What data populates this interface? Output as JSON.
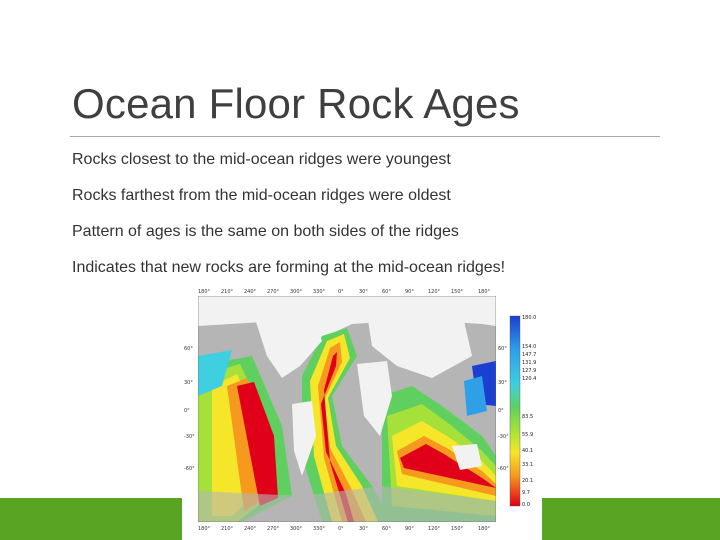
{
  "slide": {
    "title": "Ocean Floor Rock Ages",
    "bullets": [
      "Rocks closest to the mid-ocean ridges were youngest",
      "Rocks farthest from the mid-ocean ridges were oldest",
      "Pattern of ages is the same on both sides of the ridges",
      "Indicates that new rocks are forming at the mid-ocean ridges!"
    ]
  },
  "map": {
    "top_ticks": [
      "180°",
      "210°",
      "240°",
      "270°",
      "300°",
      "330°",
      "0°",
      "30°",
      "60°",
      "90°",
      "120°",
      "150°",
      "180°"
    ],
    "bottom_ticks": [
      "180°",
      "210°",
      "240°",
      "270°",
      "300°",
      "330°",
      "0°",
      "30°",
      "60°",
      "90°",
      "120°",
      "150°",
      "180°"
    ],
    "left_ticks": [
      "60°",
      "30°",
      "0°",
      "-30°",
      "-60°"
    ],
    "right_ticks": [
      "60°",
      "30°",
      "0°",
      "-30°",
      "-60°"
    ],
    "legend_labels": [
      "180.0",
      "154.0",
      "147.7",
      "131.9",
      "127.9",
      "120.4",
      "83.5",
      "55.9",
      "40.1",
      "33.1",
      "20.1",
      "9.7",
      "0.0"
    ],
    "colors": {
      "land": "#f2f2f2",
      "continental_shelf": "#b5b5b5",
      "youngest": "#e0001a",
      "oldest": "#1a3fd1"
    }
  }
}
